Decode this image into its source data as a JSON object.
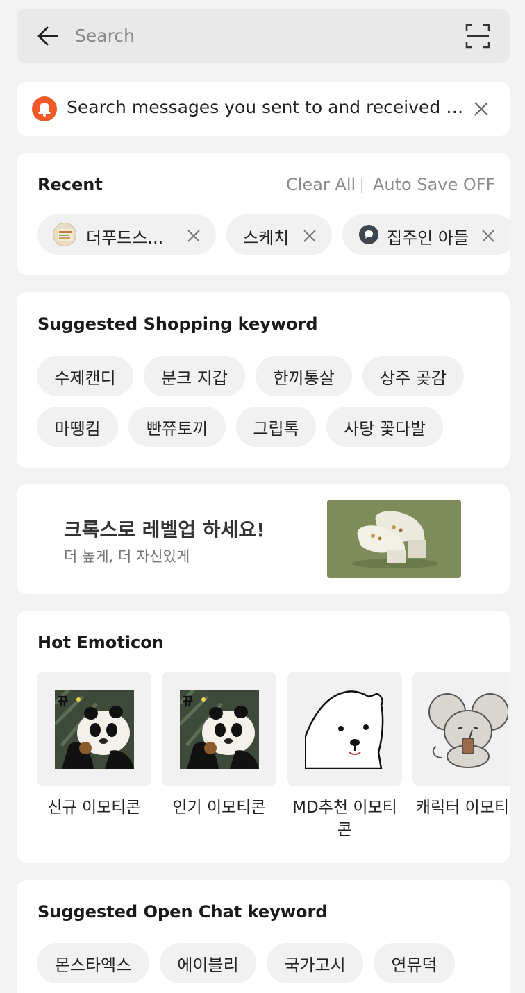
{
  "search": {
    "placeholder": "Search"
  },
  "notice": {
    "text": "Search messages you sent to and received fr..."
  },
  "recent": {
    "title": "Recent",
    "clear_all": "Clear All",
    "auto_save": "Auto Save OFF",
    "items": [
      {
        "label": "더푸드스..."
      },
      {
        "label": "스케치"
      },
      {
        "label": "집주인 아들"
      }
    ]
  },
  "shopping": {
    "title": "Suggested Shopping keyword",
    "keywords": [
      "수제캔디",
      "분크 지갑",
      "한끼통살",
      "상주 곶감",
      "마뗑킴",
      "빤쮸토끼",
      "그립톡",
      "사탕 꽃다발"
    ]
  },
  "banner": {
    "title": "크록스로 레벨업 하세요!",
    "subtitle": "더 높게, 더 자신있게"
  },
  "emoticon": {
    "title": "Hot Emoticon",
    "items": [
      {
        "label": "신규 이모티콘"
      },
      {
        "label": "인기 이모티콘"
      },
      {
        "label": "MD추천 이모티콘"
      },
      {
        "label": "캐릭터 이모티콘"
      }
    ]
  },
  "openchat": {
    "title": "Suggested Open Chat keyword",
    "keywords": [
      "몬스타엑스",
      "에이블리",
      "국가고시",
      "연뮤덕"
    ]
  },
  "colors": {
    "accent": "#f05a28",
    "page_bg": "#f3f3f3",
    "card_bg": "#ffffff",
    "chip_bg": "#f1f1f1"
  }
}
